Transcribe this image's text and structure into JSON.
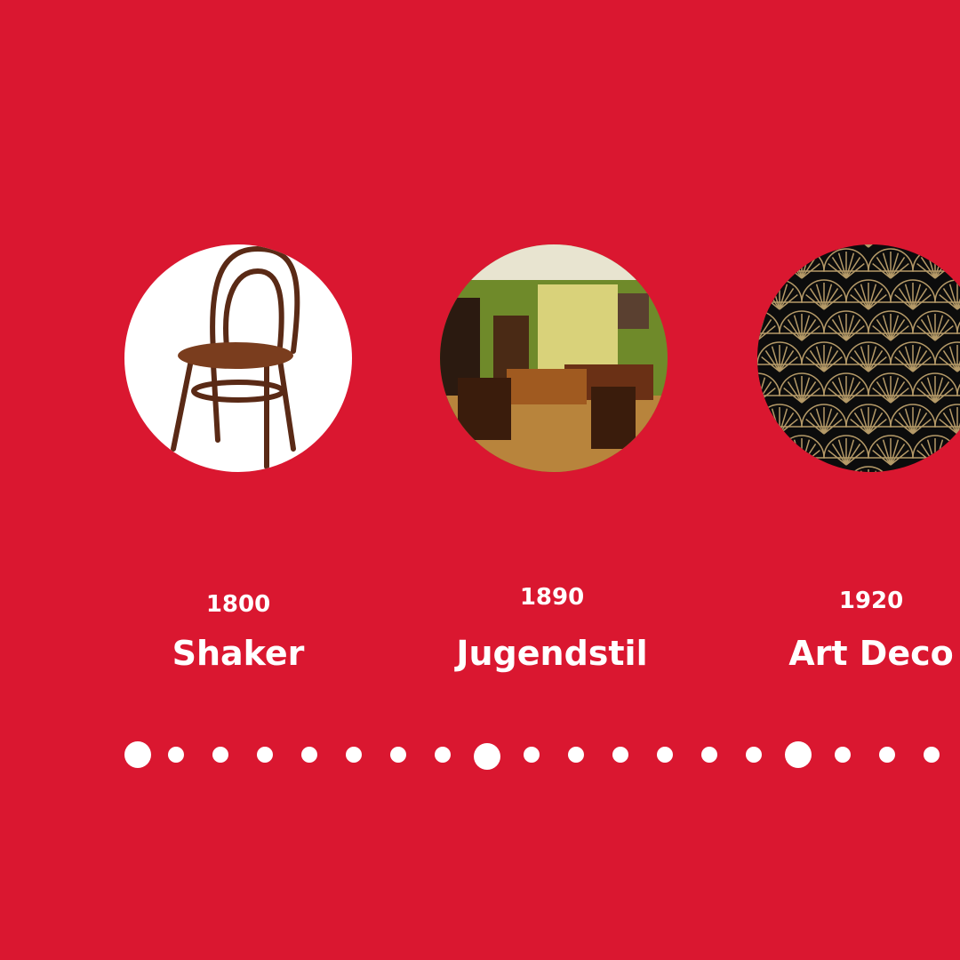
{
  "colors": {
    "background": "#DA1730",
    "text": "#FFFFFF"
  },
  "periods": [
    {
      "year": "1800",
      "name": "Shaker",
      "image": "bentwood-chair"
    },
    {
      "year": "1890",
      "name": "Jugendstil",
      "image": "art-nouveau-interior"
    },
    {
      "year": "1920",
      "name": "Art Deco",
      "image": "fan-pattern"
    }
  ],
  "timeline": {
    "dots": 19,
    "major_dot_indices": [
      0,
      8,
      15
    ]
  }
}
